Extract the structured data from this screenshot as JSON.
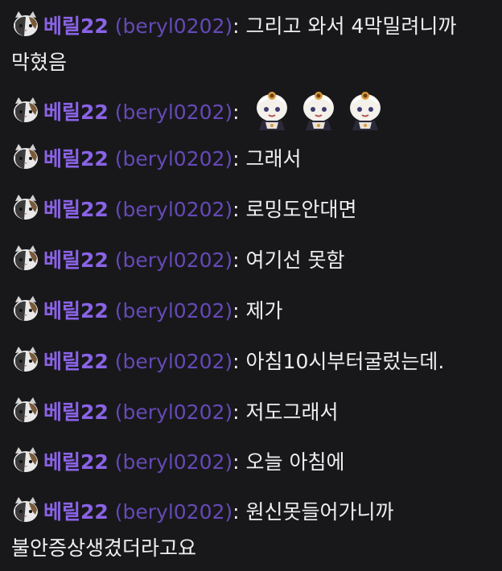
{
  "chat": {
    "badge_icon": "cat-badge-icon",
    "username_color": "#8a63e6",
    "login_color": "#6e4fc6",
    "messages": [
      {
        "user": "베릴22",
        "login": "(beryl0202)",
        "sep": ":",
        "text": "그리고 와서 4막밀려니까 막혔음"
      },
      {
        "user": "베릴22",
        "login": "(beryl0202)",
        "sep": ":",
        "text": "",
        "emotes": [
          "paimon-emote",
          "paimon-emote",
          "paimon-emote"
        ]
      },
      {
        "user": "베릴22",
        "login": "(beryl0202)",
        "sep": ":",
        "text": "그래서"
      },
      {
        "user": "베릴22",
        "login": "(beryl0202)",
        "sep": ":",
        "text": "로밍도안대면"
      },
      {
        "user": "베릴22",
        "login": "(beryl0202)",
        "sep": ":",
        "text": "여기선 못함"
      },
      {
        "user": "베릴22",
        "login": "(beryl0202)",
        "sep": ":",
        "text": "제가"
      },
      {
        "user": "베릴22",
        "login": "(beryl0202)",
        "sep": ":",
        "text": "아침10시부터굴렀는데."
      },
      {
        "user": "베릴22",
        "login": "(beryl0202)",
        "sep": ":",
        "text": "저도그래서"
      },
      {
        "user": "베릴22",
        "login": "(beryl0202)",
        "sep": ":",
        "text": "오늘 아침에"
      },
      {
        "user": "베릴22",
        "login": "(beryl0202)",
        "sep": ":",
        "text": "원신못들어가니까 불안증상생겼더라고요"
      }
    ]
  }
}
